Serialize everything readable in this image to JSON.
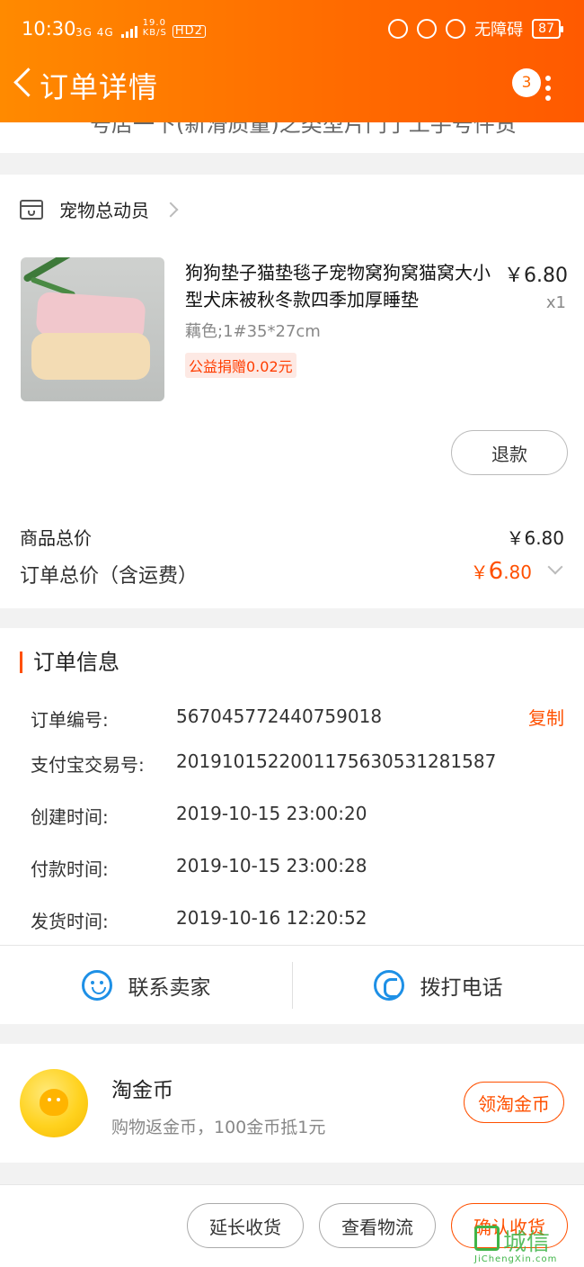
{
  "status_bar": {
    "time": "10:30",
    "network_labels": "3G 4G",
    "speed_value": "19.0",
    "speed_unit": "KB/S",
    "hd": "HD2",
    "accessibility": "无障碍",
    "battery": "87"
  },
  "nav": {
    "title": "订单详情",
    "badge_count": "3"
  },
  "top_strip": {
    "partial_text": "号店一下(新滑质量)之类型片门了工手号件货"
  },
  "shop": {
    "name": "宠物总动员"
  },
  "product": {
    "title": "狗狗垫子猫垫毯子宠物窝狗窝猫窝大小型犬床被秋冬款四季加厚睡垫",
    "price": "￥6.80",
    "qty": "x1",
    "sku": "藕色;1#35*27cm",
    "charity": "公益捐赠0.02元",
    "refund_label": "退款"
  },
  "summary": {
    "goods_total_label": "商品总价",
    "goods_total_value": "￥6.80",
    "order_total_label": "订单总价（含运费）",
    "order_total_symbol": "￥",
    "order_total_int": "6",
    "order_total_dec": ".80"
  },
  "order_info": {
    "section_title": "订单信息",
    "copy_label": "复制",
    "rows": [
      {
        "label": "订单编号:",
        "value": "567045772440759018"
      },
      {
        "label": "支付宝交易号:",
        "value": "2019101522001175630531281587"
      },
      {
        "label": "创建时间:",
        "value": "2019-10-15 23:00:20"
      },
      {
        "label": "付款时间:",
        "value": "2019-10-15 23:00:28"
      },
      {
        "label": "发货时间:",
        "value": "2019-10-16 12:20:52"
      }
    ]
  },
  "contact": {
    "seller_label": "联系卖家",
    "phone_label": "拨打电话"
  },
  "coins": {
    "title": "淘金币",
    "subtitle": "购物返金币，100金币抵1元",
    "button_label": "领淘金币"
  },
  "footer": {
    "extend_label": "延长收货",
    "logistics_label": "查看物流",
    "confirm_label": "确认收货"
  },
  "watermark": {
    "text": "城信",
    "sub": "JiChengXin.com"
  },
  "colors": {
    "header_start": "#ff8a00",
    "header_end": "#ff5a00",
    "accent": "#ff5000",
    "link_blue": "#1e90e6"
  }
}
